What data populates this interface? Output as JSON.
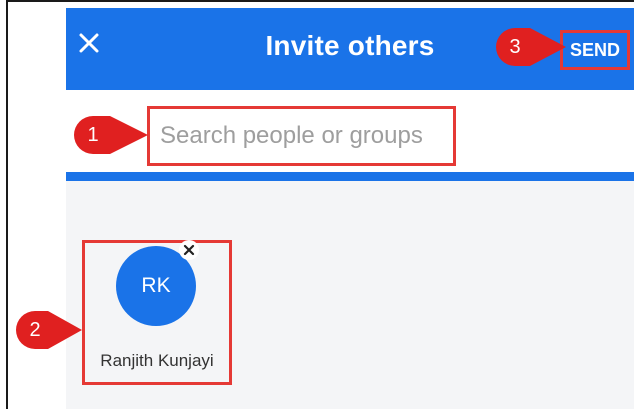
{
  "appbar": {
    "title": "Invite others",
    "send_label": "SEND",
    "close_icon": "close-icon",
    "color": "#1a73e8"
  },
  "search": {
    "placeholder": "Search people or groups",
    "value": ""
  },
  "invitees": [
    {
      "initials": "RK",
      "name": "Ranjith Kunjayi",
      "remove_icon": "close-icon"
    }
  ],
  "callouts": [
    {
      "number": "1",
      "target": "search-input"
    },
    {
      "number": "2",
      "target": "invitee-chip"
    },
    {
      "number": "3",
      "target": "send-button"
    }
  ],
  "colors": {
    "accent": "#1a73e8",
    "highlight": "#e53935",
    "callout": "#e02020"
  }
}
